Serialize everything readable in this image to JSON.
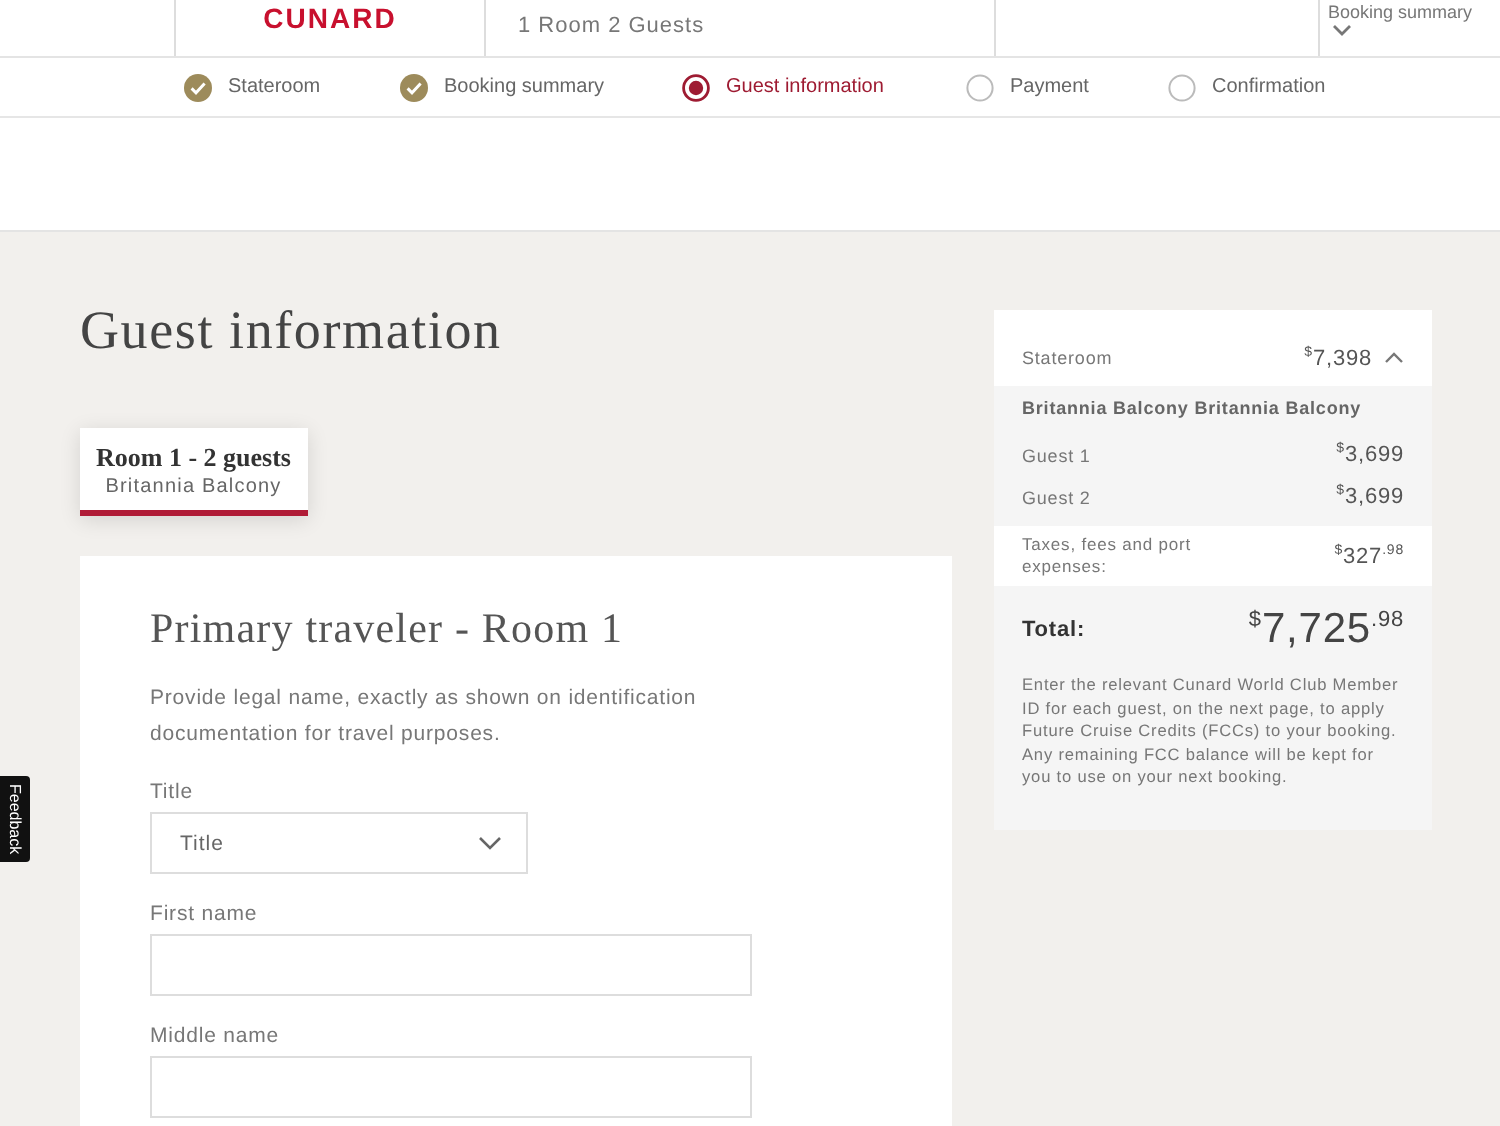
{
  "header": {
    "logo": "CUNARD",
    "party": "1 Room 2 Guests",
    "summary_toggle": "Booking summary"
  },
  "steps": [
    {
      "label": "Stateroom",
      "done": true,
      "selected": false
    },
    {
      "label": "Booking summary",
      "done": true,
      "selected": false
    },
    {
      "label": "Guest information",
      "done": false,
      "selected": true
    },
    {
      "label": "Payment",
      "done": false,
      "selected": false
    },
    {
      "label": "Confirmation",
      "done": false,
      "selected": false
    }
  ],
  "page_title": "Guest information",
  "room_tabs": [
    {
      "title": "Room 1 - 2 guests",
      "subtitle": "Britannia Balcony",
      "selected": true
    }
  ],
  "form": {
    "heading": "Primary traveler - Room 1",
    "intro": "Provide legal name, exactly as shown on identification documentation for travel purposes.",
    "fields": [
      {
        "kind": "select",
        "label": "Title",
        "placeholder": "Title"
      },
      {
        "kind": "text",
        "label": "First name"
      },
      {
        "kind": "text",
        "label": "Middle name"
      }
    ]
  },
  "summary": {
    "stateroom_label": "Stateroom",
    "stateroom_price": {
      "currency": "$",
      "amount": "7,398"
    },
    "expanded": true,
    "room_name": "Britannia Balcony Britannia Balcony",
    "guests": [
      {
        "label": "Guest 1",
        "price": {
          "currency": "$",
          "amount": "3,699"
        }
      },
      {
        "label": "Guest 2",
        "price": {
          "currency": "$",
          "amount": "3,699"
        }
      }
    ],
    "taxes_label": "Taxes, fees and port expenses:",
    "taxes_price": {
      "currency": "$",
      "amount": "327",
      "cents": ".98"
    },
    "total_label": "Total:",
    "total_price": {
      "currency": "$",
      "amount": "7,725",
      "cents": ".98"
    },
    "note": "Enter the relevant Cunard World Club Member ID for each guest, on the next page, to apply Future Cruise Credits (FCCs) to your booking. Any remaining FCC balance will be kept for you to use on your next booking."
  },
  "feedback_tab": "Feedback"
}
